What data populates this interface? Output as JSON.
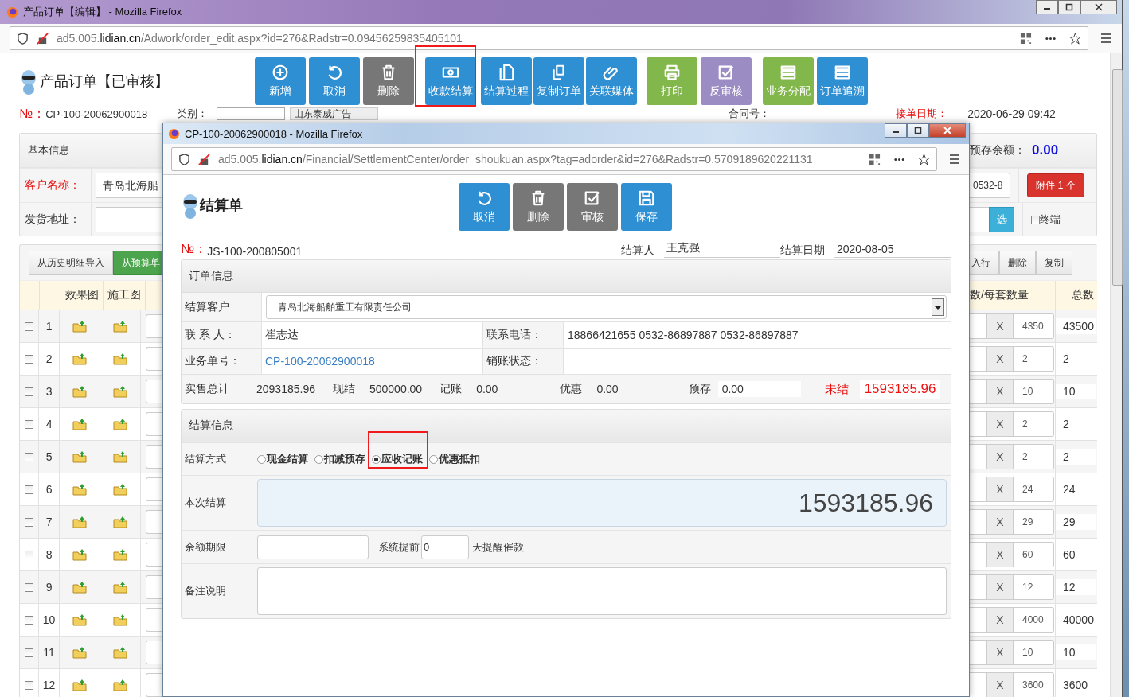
{
  "main_window": {
    "title": "产品订单【编辑】 - Mozilla Firefox",
    "url": "ad5.005.**lidian.cn**/Adwork/order_edit.aspx?id=276&Radstr=0.09456259835405101"
  },
  "page_title": "产品订单【已审核】",
  "toolbar": [
    {
      "label": "新增",
      "kind": "add",
      "color": "#2f8fd3",
      "highlighted": false
    },
    {
      "label": "取消",
      "kind": "undo",
      "color": "#2f8fd3",
      "highlighted": false
    },
    {
      "label": "删除",
      "kind": "trash",
      "color": "#777777",
      "highlighted": false
    },
    {
      "label": "收款结算",
      "kind": "money",
      "color": "#2f8fd3",
      "highlighted": true
    },
    {
      "label": "结算过程",
      "kind": "document",
      "color": "#2f8fd3",
      "highlighted": false
    },
    {
      "label": "复制订单",
      "kind": "copy",
      "color": "#2f8fd3",
      "highlighted": false
    },
    {
      "label": "关联媒体",
      "kind": "clip",
      "color": "#2f8fd3",
      "highlighted": false
    },
    {
      "label": "打印",
      "kind": "print",
      "color": "#82b74b",
      "highlighted": false
    },
    {
      "label": "反审核",
      "kind": "check",
      "color": "#9c8cc4",
      "highlighted": false
    },
    {
      "label": "业务分配",
      "kind": "list",
      "color": "#82b74b",
      "highlighted": false
    },
    {
      "label": "订单追溯",
      "kind": "list",
      "color": "#2f8fd3",
      "highlighted": false
    }
  ],
  "order_no": {
    "label": "№：",
    "value": "CP-100-20062900018"
  },
  "category_label": "类别：",
  "company_select": "山东泰威广告",
  "contract_label": "合同号：",
  "date_label": "接单日期：",
  "date_value": "2020-06-29 09:42",
  "basic_info": {
    "title": "基本信息",
    "customer_label": "客户名称：",
    "customer_value": "青岛北海船",
    "address_label": "发货地址：",
    "prepaid_label": "预存余额：",
    "prepaid_value": "0.00",
    "phone_value": "0532-8",
    "attachment_button": "附件 1 个",
    "select_button": "选",
    "terminal": {
      "label": "终端",
      "checked": false
    }
  },
  "detail": {
    "left_buttons": [
      "从历史明细导入",
      "从预算单"
    ],
    "right_buttons": [
      "入行",
      "删除",
      "复制"
    ],
    "columns": [
      "效果图",
      "施工图",
      "数/每套数量",
      "总数"
    ],
    "rows": [
      {
        "no": "1",
        "checked": false,
        "x_sign": "X",
        "qty": "4350",
        "total": "43500"
      },
      {
        "no": "2",
        "checked": false,
        "x_sign": "X",
        "qty": "2",
        "total": "2"
      },
      {
        "no": "3",
        "checked": false,
        "x_sign": "X",
        "qty": "10",
        "total": "10"
      },
      {
        "no": "4",
        "checked": false,
        "x_sign": "X",
        "qty": "2",
        "total": "2"
      },
      {
        "no": "5",
        "checked": false,
        "x_sign": "X",
        "qty": "2",
        "total": "2"
      },
      {
        "no": "6",
        "checked": false,
        "x_sign": "X",
        "qty": "24",
        "total": "24"
      },
      {
        "no": "7",
        "checked": false,
        "x_sign": "X",
        "qty": "29",
        "total": "29"
      },
      {
        "no": "8",
        "checked": false,
        "x_sign": "X",
        "qty": "60",
        "total": "60"
      },
      {
        "no": "9",
        "checked": false,
        "x_sign": "X",
        "qty": "12",
        "total": "12"
      },
      {
        "no": "10",
        "checked": false,
        "x_sign": "X",
        "qty": "4000",
        "total": "40000"
      },
      {
        "no": "11",
        "checked": false,
        "x_sign": "X",
        "qty": "10",
        "total": "10"
      },
      {
        "no": "12",
        "checked": false,
        "x_sign": "X",
        "qty": "3600",
        "total": "3600"
      }
    ]
  },
  "popup": {
    "title": "CP-100-20062900018 - Mozilla Firefox",
    "url": "ad5.005.**lidian.cn**/Financial/SettlementCenter/order_shoukuan.aspx?tag=adorder&id=276&Radstr=0.5709189620221131",
    "page_title": "结算单",
    "buttons": [
      {
        "label": "取消",
        "kind": "undo",
        "color": "#2f8fd3"
      },
      {
        "label": "删除",
        "kind": "trash",
        "color": "#777777"
      },
      {
        "label": "审核",
        "kind": "check",
        "color": "#777777"
      },
      {
        "label": "保存",
        "kind": "save",
        "color": "#2f8fd3"
      }
    ],
    "number_label": "№：",
    "number": "JS-100-200805001",
    "settler_label": "结算人",
    "settler": "王克强",
    "date_label": "结算日期",
    "date": "2020-08-05",
    "order_info": {
      "title": "订单信息",
      "customer_label": "结算客户",
      "customer": "青岛北海船舶重工有限责任公司",
      "contact_label": "联 系 人：",
      "contact": "崔志达",
      "phone_label": "联系电话：",
      "phone": "18866421655 0532-86897887 0532-86897887",
      "order_no_label": "业务单号：",
      "order_no": "CP-100-20062900018",
      "writeoff_label": "销账状态：",
      "totals": [
        {
          "label": "实售总计",
          "value": "2093185.96",
          "kind": "text"
        },
        {
          "label": "现结",
          "value": "500000.00",
          "kind": "text"
        },
        {
          "label": "记账",
          "value": "0.00",
          "kind": "text"
        },
        {
          "label": "优惠",
          "value": "0.00",
          "kind": "text"
        },
        {
          "label": "预存",
          "value": "0.00",
          "kind": "field"
        }
      ],
      "unpaid_label": "未结",
      "unpaid": "1593185.96"
    },
    "settle_info": {
      "title": "结算信息",
      "method_label": "结算方式",
      "methods": [
        {
          "label": "现金结算",
          "selected": false,
          "highlighted": false
        },
        {
          "label": "扣减预存",
          "selected": false,
          "highlighted": false
        },
        {
          "label": "应收记账",
          "selected": true,
          "highlighted": true
        },
        {
          "label": "优惠抵扣",
          "selected": false,
          "highlighted": false
        }
      ],
      "amount_label": "本次结算",
      "amount": "1593185.96",
      "term_label": "余额期限",
      "remind_before": "系统提前",
      "remind_days": "0",
      "remind_after": "天提醒催款",
      "note_label": "备注说明"
    }
  }
}
